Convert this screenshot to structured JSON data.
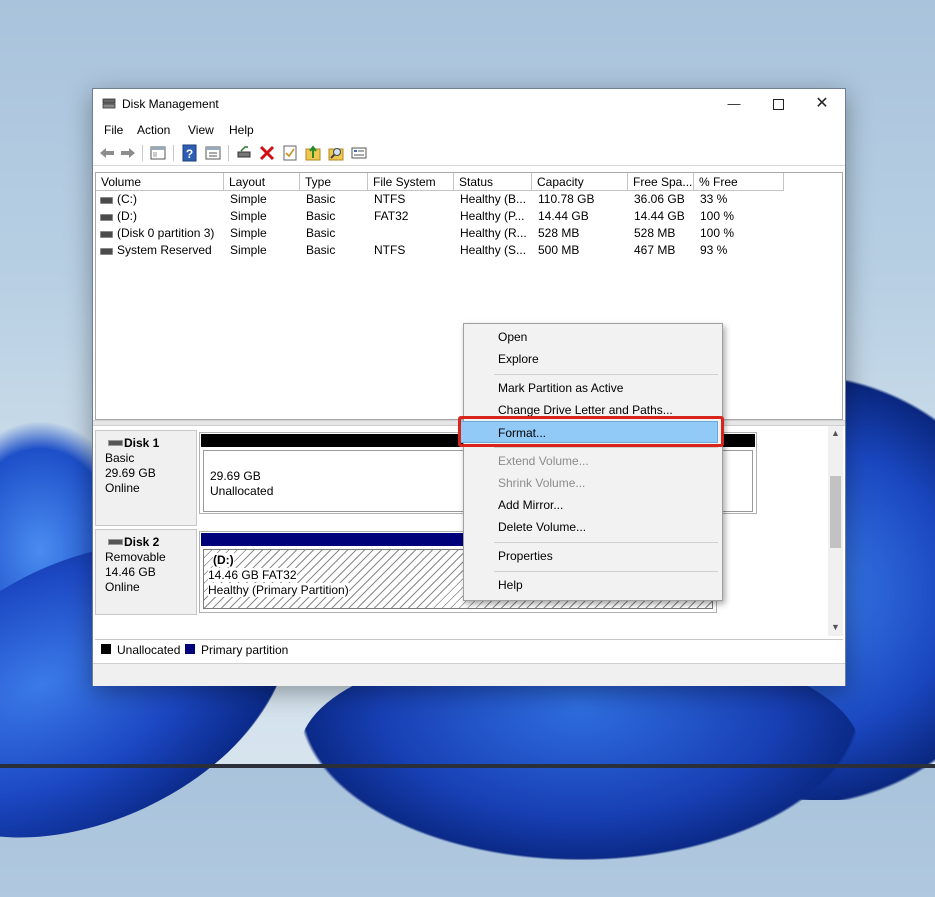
{
  "window": {
    "title": "Disk Management"
  },
  "menubar": {
    "items": [
      "File",
      "Action",
      "View",
      "Help"
    ]
  },
  "volume_list": {
    "columns": [
      "Volume",
      "Layout",
      "Type",
      "File System",
      "Status",
      "Capacity",
      "Free Spa...",
      "% Free"
    ],
    "rows": [
      [
        "(C:)",
        "Simple",
        "Basic",
        "NTFS",
        "Healthy (B...",
        "110.78 GB",
        "36.06 GB",
        "33 %"
      ],
      [
        "(D:)",
        "Simple",
        "Basic",
        "FAT32",
        "Healthy (P...",
        "14.44 GB",
        "14.44 GB",
        "100 %"
      ],
      [
        "(Disk 0 partition 3)",
        "Simple",
        "Basic",
        "",
        "Healthy (R...",
        "528 MB",
        "528 MB",
        "100 %"
      ],
      [
        "System Reserved",
        "Simple",
        "Basic",
        "NTFS",
        "Healthy (S...",
        "500 MB",
        "467 MB",
        "93 %"
      ]
    ]
  },
  "disks": [
    {
      "name": "Disk 1",
      "type": "Basic",
      "size": "29.69 GB",
      "state": "Online",
      "partition": {
        "size": "29.69 GB",
        "label": "Unallocated",
        "bar_color": "#000000"
      }
    },
    {
      "name": "Disk 2",
      "type": "Removable",
      "size": "14.46 GB",
      "state": "Online",
      "partition": {
        "letter": "(D:)",
        "size_fs": "14.46 GB FAT32",
        "status": "Healthy (Primary Partition)",
        "bar_color": "#00007b"
      }
    }
  ],
  "legend": [
    {
      "label": "Unallocated",
      "color": "#000000"
    },
    {
      "label": "Primary partition",
      "color": "#00007b"
    }
  ],
  "context_menu": {
    "items": [
      {
        "label": "Open",
        "enabled": true
      },
      {
        "label": "Explore",
        "enabled": true
      },
      {
        "label": "Mark Partition as Active",
        "enabled": true
      },
      {
        "label": "Change Drive Letter and Paths...",
        "enabled": true
      },
      {
        "label": "Format...",
        "enabled": true,
        "highlighted": true
      },
      {
        "label": "Extend Volume...",
        "enabled": false
      },
      {
        "label": "Shrink Volume...",
        "enabled": false
      },
      {
        "label": "Add Mirror...",
        "enabled": true
      },
      {
        "label": "Delete Volume...",
        "enabled": true
      },
      {
        "label": "Properties",
        "enabled": true
      },
      {
        "label": "Help",
        "enabled": true
      }
    ]
  },
  "toolbar": {
    "icons": [
      "back-icon",
      "forward-icon",
      "show-hide-console-tree-icon",
      "help-icon",
      "properties-icon",
      "connect-drive-icon",
      "delete-icon",
      "check-icon",
      "export-icon",
      "search-icon",
      "view-icon"
    ]
  },
  "colors": {
    "highlight": "#91c9f7",
    "annotation_box": "#d9241c"
  }
}
